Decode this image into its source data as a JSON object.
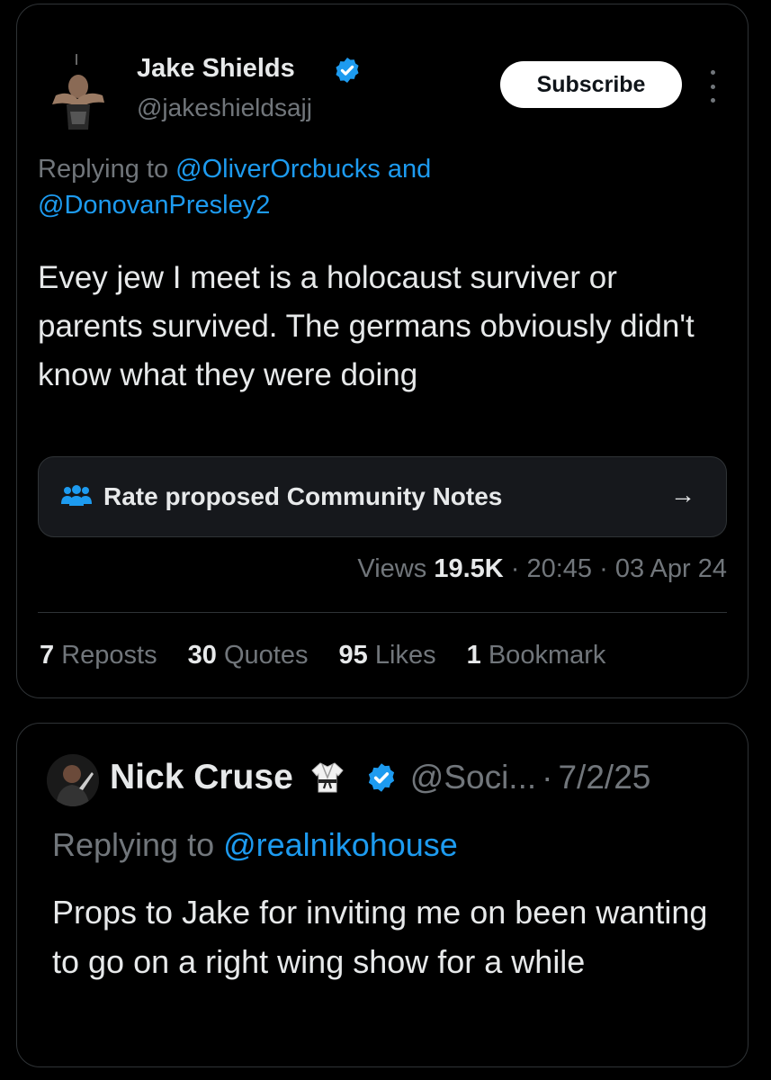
{
  "tweet": {
    "author_name": "Jake Shields",
    "author_handle": "@jakeshieldsajj",
    "subscribe_label": "Subscribe",
    "replying_prefix": "Replying to ",
    "replying_mention_1": "@OliverOrcbucks",
    "replying_and": " and ",
    "replying_mention_2": "@DonovanPresley2",
    "text": "Evey jew I meet is a holocaust surviver or parents survived.   The germans obviously didn't know what they were doing",
    "community_notes_label": "Rate proposed Community Notes",
    "community_notes_arrow": "→",
    "views_label": "Views",
    "views_count": "19.5K",
    "sep": " · ",
    "time": "20:45",
    "date": "03 Apr 24",
    "stats": [
      {
        "count": "7",
        "label": "Reposts"
      },
      {
        "count": "30",
        "label": "Quotes"
      },
      {
        "count": "95",
        "label": "Likes"
      },
      {
        "count": "1",
        "label": "Bookmark"
      }
    ]
  },
  "reply": {
    "author_name": "Nick Cruse",
    "author_handle": "@Soci...",
    "sep": "·",
    "date": "7/2/25",
    "replying_prefix": "Replying to ",
    "replying_mention": "@realnikohouse",
    "text": "Props to Jake for inviting me on been wanting to go on a right wing show for a while"
  },
  "colors": {
    "background": "#000000",
    "text": "#e7e9ea",
    "secondary": "#71767b",
    "accent": "#1d9bf0",
    "border": "#2f3336"
  },
  "icons": [
    "verified-badge-icon",
    "more-options-icon",
    "community-notes-icon",
    "arrow-right-icon",
    "karate-gi-icon"
  ]
}
